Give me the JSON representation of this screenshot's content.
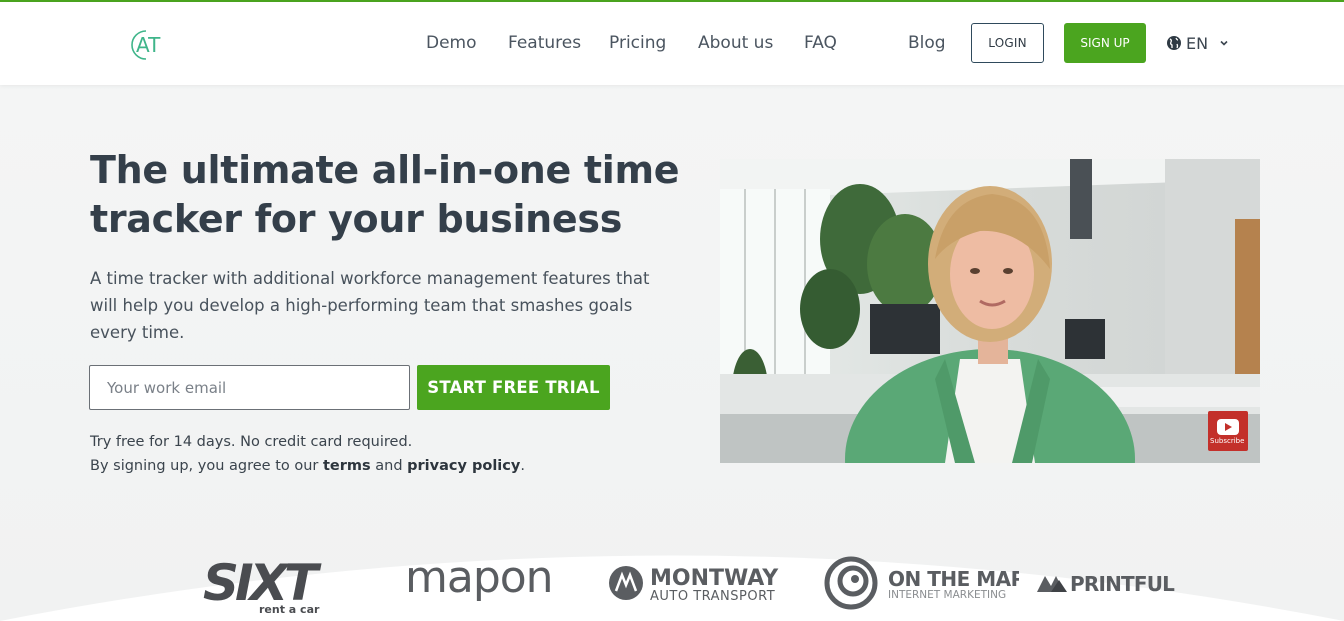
{
  "brand": {
    "logo_text": "AT",
    "accent": "#4ba51f",
    "text_dark": "#343f4a"
  },
  "nav": {
    "items": [
      {
        "label": "Demo"
      },
      {
        "label": "Features"
      },
      {
        "label": "Pricing"
      },
      {
        "label": "About us"
      },
      {
        "label": "FAQ"
      },
      {
        "label": "Blog"
      }
    ],
    "login_label": "LOGIN",
    "signup_label": "SIGN UP",
    "language": "EN"
  },
  "hero": {
    "title_line1": "The ultimate all-in-one time",
    "title_line2": "tracker for your business",
    "lead": "A time tracker with additional workforce management features that will help you develop a high-performing team that smashes goals every time.",
    "email_placeholder": "Your work email",
    "email_value": "",
    "cta_label": "START FREE TRIAL",
    "note_line1": "Try free for 14 days. No credit card required.",
    "note_line2_prefix": "By signing up, you agree to our",
    "note_terms": "terms",
    "note_and": "and",
    "note_privacy": "privacy policy",
    "note_period": "."
  },
  "video": {
    "subscribe_label": "Subscribe",
    "player_icon": "youtube-icon"
  },
  "client_logos": [
    {
      "name": "SIXT",
      "tagline": "rent a car"
    },
    {
      "name": "mapon",
      "tagline": ""
    },
    {
      "name": "MONTWAY",
      "tagline": "AUTO TRANSPORT"
    },
    {
      "name": "ON THE MAP",
      "tagline": "INTERNET MARKETING"
    },
    {
      "name": "PRINTFUL",
      "tagline": ""
    }
  ]
}
